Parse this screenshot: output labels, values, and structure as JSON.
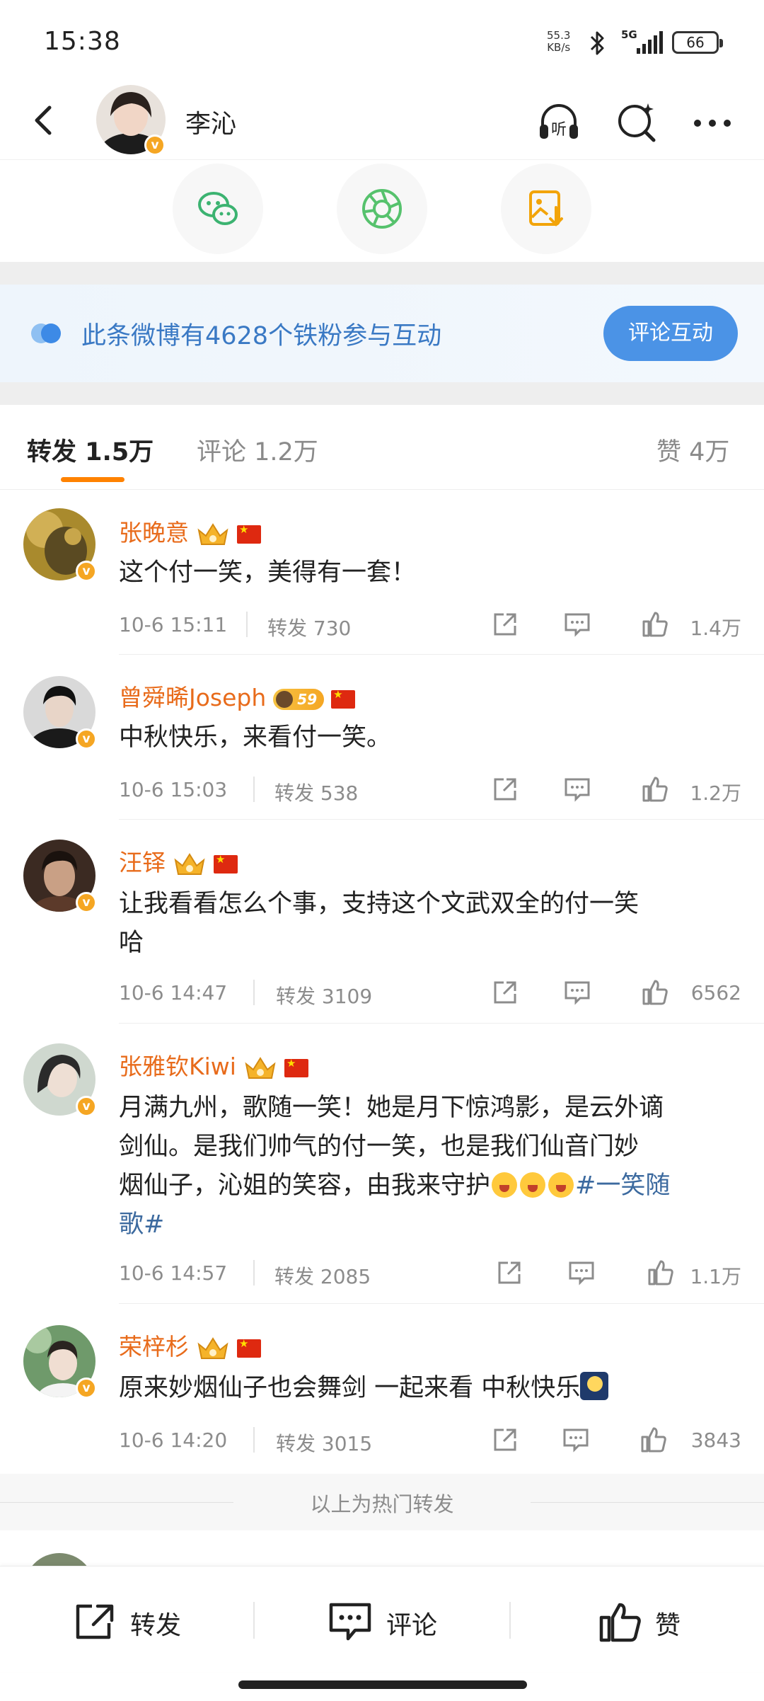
{
  "status_bar": {
    "time": "15:38",
    "net_speed_value": "55.3",
    "net_speed_unit": "KB/s",
    "signal_label": "5G",
    "battery": "66"
  },
  "nav": {
    "username": "李沁"
  },
  "fan_banner": {
    "text": "此条微博有4628个铁粉参与互动",
    "button": "评论互动"
  },
  "tabs": {
    "repost": "转发 1.5万",
    "comment": "评论 1.2万",
    "like": "赞 4万"
  },
  "posts": [
    {
      "name": "张晚意",
      "text": "这个付一笑，美得有一套！",
      "date": "10-6 15:11",
      "reposts": "转发 730",
      "likes": "1.4万"
    },
    {
      "name": "曾舜晞Joseph",
      "level": "59",
      "text": "中秋快乐，来看付一笑。",
      "date": "10-6 15:03",
      "reposts": "转发 538",
      "likes": "1.2万"
    },
    {
      "name": "汪铎",
      "text_line1": "让我看看怎么个事，支持这个文武双全的付一笑",
      "text_line2": "哈",
      "date": "10-6 14:47",
      "reposts": "转发 3109",
      "likes": "6562"
    },
    {
      "name": "张雅钦Kiwi",
      "text_line1": "月满九州，歌随一笑！她是月下惊鸿影，是云外谪",
      "text_line2": "剑仙。是我们帅气的付一笑，也是我们仙音门妙",
      "text_line3": "烟仙子，沁姐的笑容，由我来守护",
      "hashtag_a": "#一笑随",
      "hashtag_b": "歌#",
      "date": "10-6 14:57",
      "reposts": "转发 2085",
      "likes": "1.1万"
    },
    {
      "name": "荣梓杉",
      "text": "原来妙烟仙子也会舞剑 一起来看 中秋快乐",
      "date": "10-6 14:20",
      "reposts": "转发 3015",
      "likes": "3843"
    }
  ],
  "footer_note": "以上为热门转发",
  "action_bar": {
    "repost": "转发",
    "comment": "评论",
    "like": "赞"
  },
  "colors": {
    "accent_orange": "#ff8200",
    "username_orange": "#e86b1b",
    "link_blue": "#3c6a9f",
    "button_blue": "#4b93e6"
  }
}
